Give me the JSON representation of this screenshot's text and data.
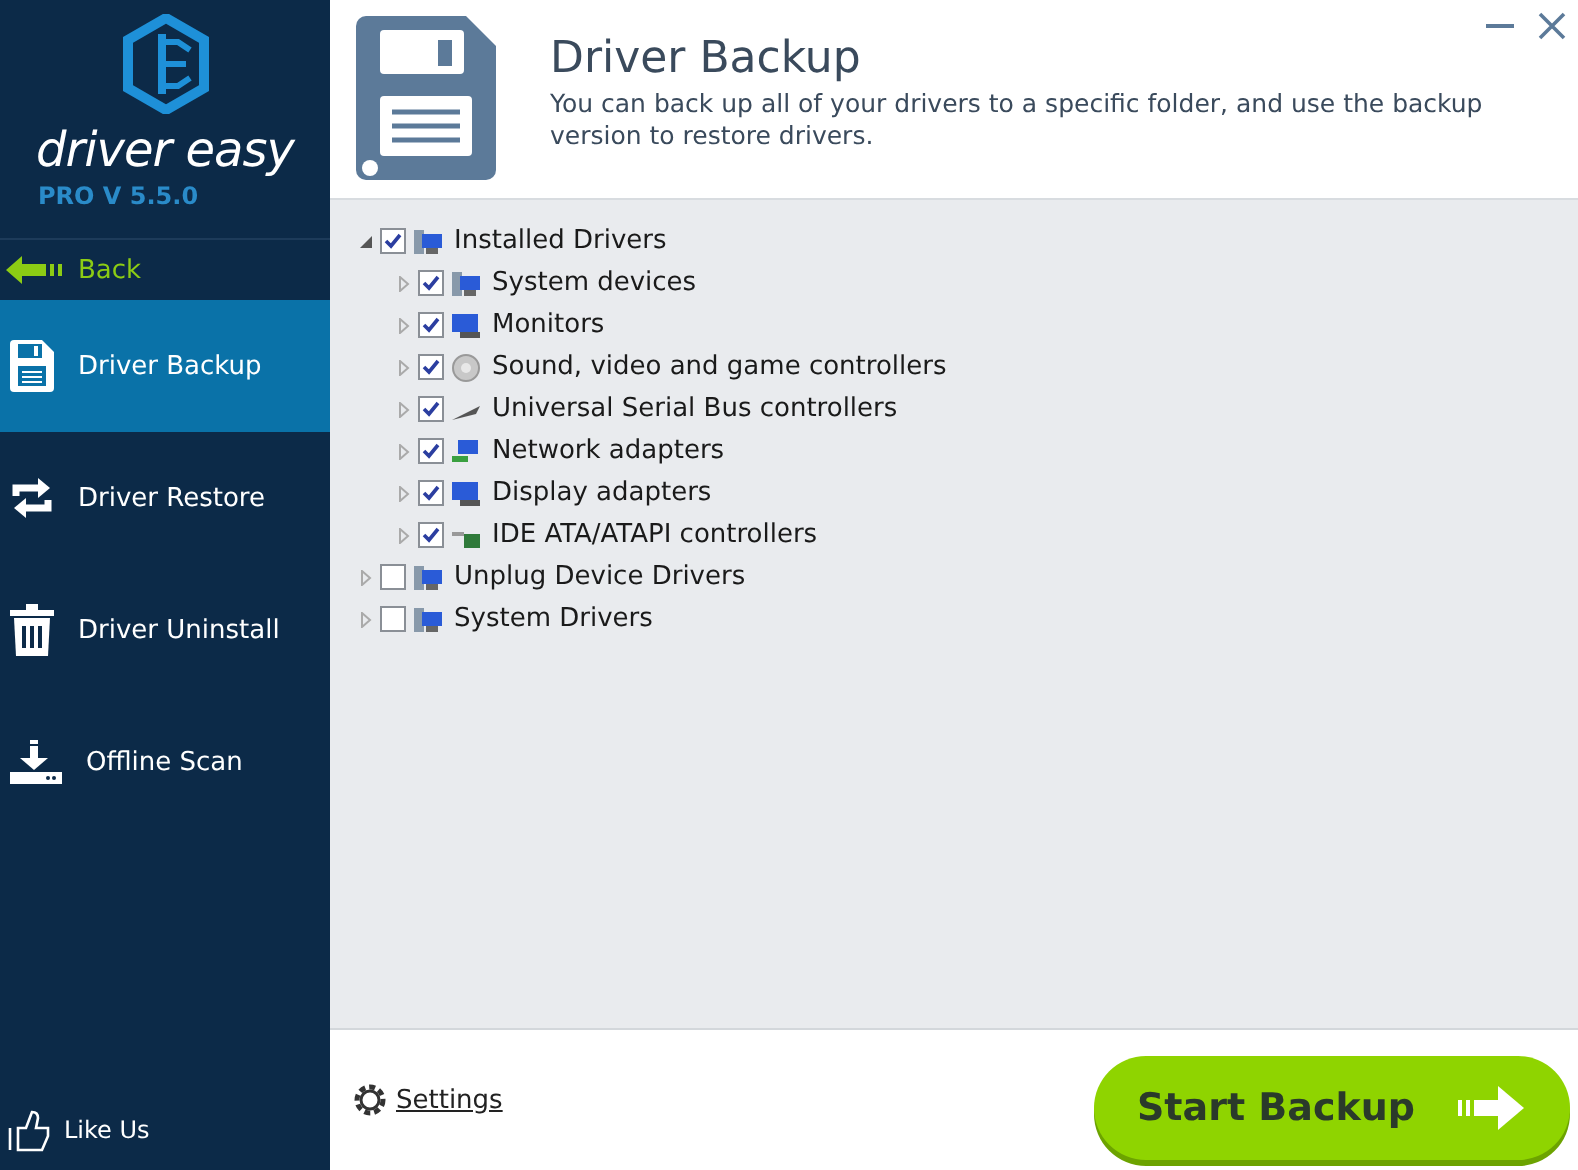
{
  "app": {
    "logo_text": "driver easy",
    "version": "PRO V 5.5.0"
  },
  "back": {
    "label": "Back"
  },
  "nav": [
    {
      "label": "Driver Backup",
      "kind": "backup",
      "selected": true
    },
    {
      "label": "Driver Restore",
      "kind": "restore",
      "selected": false
    },
    {
      "label": "Driver Uninstall",
      "kind": "uninstall",
      "selected": false
    },
    {
      "label": "Offline Scan",
      "kind": "scan",
      "selected": false
    }
  ],
  "like": {
    "label": "Like Us"
  },
  "header": {
    "title": "Driver Backup",
    "description": "You can back up all of your drivers to a specific folder, and use the backup version to restore drivers."
  },
  "tree": [
    {
      "label": "Installed Drivers",
      "kind": "computer",
      "checked": true,
      "expanded": true,
      "children": [
        {
          "label": "System devices",
          "kind": "computer",
          "checked": true,
          "expanded": false
        },
        {
          "label": "Monitors",
          "kind": "monitor",
          "checked": true,
          "expanded": false
        },
        {
          "label": "Sound, video and game controllers",
          "kind": "speaker",
          "checked": true,
          "expanded": false
        },
        {
          "label": "Universal Serial Bus controllers",
          "kind": "usb",
          "checked": true,
          "expanded": false
        },
        {
          "label": "Network adapters",
          "kind": "network",
          "checked": true,
          "expanded": false
        },
        {
          "label": "Display adapters",
          "kind": "monitor",
          "checked": true,
          "expanded": false
        },
        {
          "label": "IDE ATA/ATAPI controllers",
          "kind": "drive",
          "checked": true,
          "expanded": false
        }
      ]
    },
    {
      "label": "Unplug Device Drivers",
      "kind": "computer",
      "checked": false,
      "expanded": false
    },
    {
      "label": "System Drivers",
      "kind": "computer",
      "checked": false,
      "expanded": false
    }
  ],
  "footer": {
    "settings": "Settings",
    "start": "Start Backup"
  }
}
